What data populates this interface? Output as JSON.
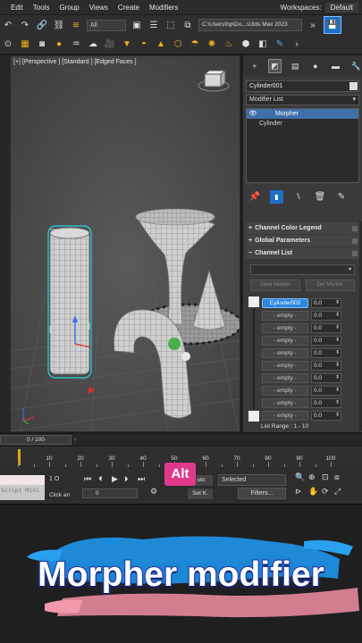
{
  "menu": [
    "Edit",
    "Tools",
    "Group",
    "Views",
    "Create",
    "Modifiers"
  ],
  "workspace": {
    "label": "Workspaces:",
    "value": "Default"
  },
  "toolbar": {
    "select_filter": "All",
    "project_path": "C:\\Users\\hp\\Do...s\\3ds Max 2023"
  },
  "viewport": {
    "label": "[+] [Perspective ] [Standard ] [Edged Faces ]"
  },
  "command_panel": {
    "object_name": "Cylinder001",
    "modifier_list_label": "Modifier List",
    "stack": [
      "Morpher",
      "Cylinder"
    ],
    "rollouts": [
      "Channel Color Legend",
      "Global Parameters",
      "Channel List"
    ],
    "save_marker_label": "Save Marker",
    "del_marker_label": "Del Marker",
    "channels": [
      {
        "label": "Cylinder002",
        "value": "0.0",
        "active": true
      },
      {
        "label": "- empty -",
        "value": "0.0"
      },
      {
        "label": "- empty -",
        "value": "0.0"
      },
      {
        "label": "- empty -",
        "value": "0.0"
      },
      {
        "label": "- empty -",
        "value": "0.0"
      },
      {
        "label": "- empty -",
        "value": "0.0"
      },
      {
        "label": "- empty -",
        "value": "0.0"
      },
      {
        "label": "- empty -",
        "value": "0.0"
      },
      {
        "label": "- empty -",
        "value": "0.0"
      },
      {
        "label": "- empty -",
        "value": "0.0"
      }
    ],
    "list_range": "List Range :  1 - 10"
  },
  "timeline": {
    "slider_label": "0 / 100",
    "ticks": [
      "10",
      "20",
      "30",
      "40",
      "50",
      "60",
      "70",
      "80",
      "90",
      "100"
    ]
  },
  "status": {
    "maxscript": "Script Mini",
    "line1": "1 O",
    "line2": "Click an",
    "frame_value": "0",
    "key_badge": "Alt",
    "auto_label": "uto",
    "setkey_label": "Set K.",
    "selected_label": "Selected",
    "filters_label": "Filters..."
  },
  "caption": "Morpher modifier"
}
